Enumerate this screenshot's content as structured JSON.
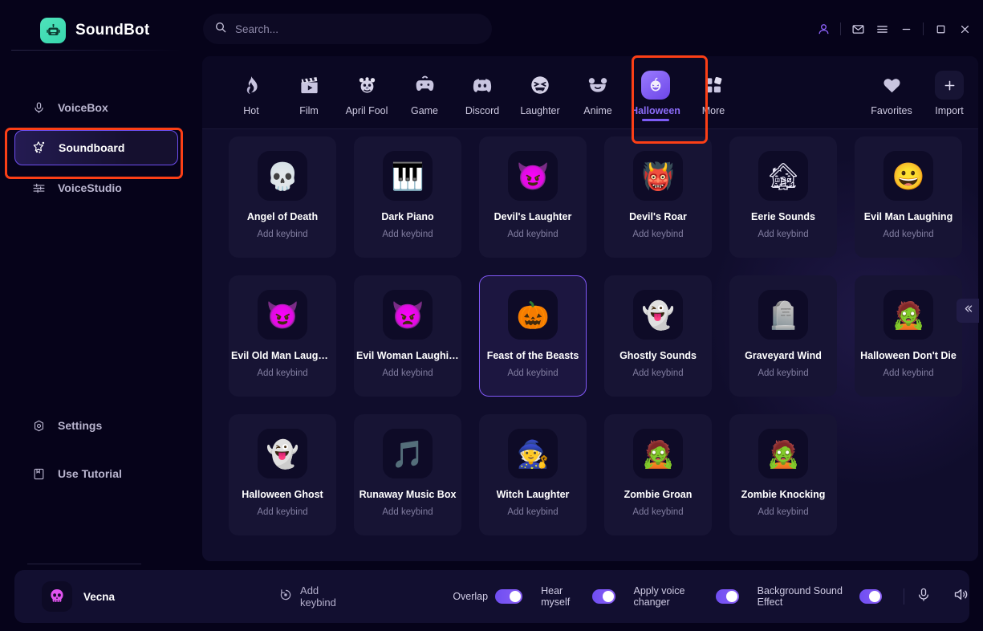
{
  "app": {
    "title": "SoundBot",
    "logo_icon": "robot-icon"
  },
  "search": {
    "placeholder": "Search...",
    "value": "",
    "icon": "search-icon"
  },
  "window_controls": [
    {
      "name": "account-icon",
      "glyph": "\u0000"
    },
    {
      "name": "mail-icon",
      "glyph": "\u0000"
    },
    {
      "name": "menu-icon",
      "glyph": "\u0000"
    },
    {
      "name": "minimize-icon",
      "glyph": "\u0000"
    },
    {
      "name": "maximize-icon",
      "glyph": "\u0000"
    },
    {
      "name": "close-icon",
      "glyph": "\u0000"
    }
  ],
  "sidebar": {
    "items": [
      {
        "label": "VoiceBox",
        "icon": "microphone-icon",
        "active": false
      },
      {
        "label": "Soundboard",
        "icon": "magic-wand-icon",
        "active": true
      },
      {
        "label": "VoiceStudio",
        "icon": "sliders-icon",
        "active": false
      }
    ],
    "bottom_items": [
      {
        "label": "Settings",
        "icon": "gear-icon"
      },
      {
        "label": "Use Tutorial",
        "icon": "book-icon"
      }
    ],
    "mini_icons": [
      {
        "name": "gift-box-icon"
      },
      {
        "name": "chat-bubble-icon"
      }
    ]
  },
  "tabs": [
    {
      "label": "Hot",
      "icon": "flame-icon",
      "active": false
    },
    {
      "label": "Film",
      "icon": "clapperboard-icon",
      "active": false
    },
    {
      "label": "April Fool",
      "icon": "clown-icon",
      "active": false
    },
    {
      "label": "Game",
      "icon": "gamepad-icon",
      "active": false
    },
    {
      "label": "Discord",
      "icon": "discord-icon",
      "active": false
    },
    {
      "label": "Laughter",
      "icon": "laughing-face-icon",
      "active": false
    },
    {
      "label": "Anime",
      "icon": "bear-face-icon",
      "active": false
    },
    {
      "label": "Halloween",
      "icon": "pumpkin-icon",
      "active": true
    },
    {
      "label": "More",
      "icon": "grid-icon",
      "active": false
    }
  ],
  "tabs_right": [
    {
      "label": "Favorites",
      "icon": "heart-icon"
    },
    {
      "label": "Import",
      "icon": "plus-icon"
    }
  ],
  "sounds": [
    {
      "title": "Angel of Death",
      "keybind": "Add keybind",
      "icon": "skull-scythe-icon",
      "emoji": "💀",
      "selected": false
    },
    {
      "title": "Dark Piano",
      "keybind": "Add keybind",
      "icon": "piano-icon",
      "emoji": "🎹",
      "selected": false
    },
    {
      "title": "Devil's Laughter",
      "keybind": "Add keybind",
      "icon": "devil-icon",
      "emoji": "😈",
      "selected": false
    },
    {
      "title": "Devil's Roar",
      "keybind": "Add keybind",
      "icon": "devil-roar-icon",
      "emoji": "👹",
      "selected": false
    },
    {
      "title": "Eerie Sounds",
      "keybind": "Add keybind",
      "icon": "haunted-house-icon",
      "emoji": "🏚",
      "selected": false
    },
    {
      "title": "Evil Man Laughing",
      "keybind": "Add keybind",
      "icon": "grinning-man-icon",
      "emoji": "😀",
      "selected": false
    },
    {
      "title": "Evil Old Man Laughing",
      "keybind": "Add keybind",
      "icon": "old-man-icon",
      "emoji": "😈",
      "selected": false
    },
    {
      "title": "Evil Woman Laughing",
      "keybind": "Add keybind",
      "icon": "she-devil-icon",
      "emoji": "👿",
      "selected": false
    },
    {
      "title": "Feast of the Beasts",
      "keybind": "Add keybind",
      "icon": "candy-skull-icon",
      "emoji": "🎃",
      "selected": true
    },
    {
      "title": "Ghostly Sounds",
      "keybind": "Add keybind",
      "icon": "ghost-icon",
      "emoji": "👻",
      "selected": false
    },
    {
      "title": "Graveyard Wind",
      "keybind": "Add keybind",
      "icon": "tombstone-icon",
      "emoji": "🪦",
      "selected": false
    },
    {
      "title": "Halloween Don't Die",
      "keybind": "Add keybind",
      "icon": "zombie-hand-icon",
      "emoji": "🧟",
      "selected": false
    },
    {
      "title": "Halloween Ghost",
      "keybind": "Add keybind",
      "icon": "evil-ghost-icon",
      "emoji": "👻",
      "selected": false
    },
    {
      "title": "Runaway Music Box",
      "keybind": "Add keybind",
      "icon": "music-box-icon",
      "emoji": "🎵",
      "selected": false
    },
    {
      "title": "Witch Laughter",
      "keybind": "Add keybind",
      "icon": "witch-icon",
      "emoji": "🧙",
      "selected": false
    },
    {
      "title": "Zombie Groan",
      "keybind": "Add keybind",
      "icon": "zombie-icon",
      "emoji": "🧟",
      "selected": false
    },
    {
      "title": "Zombie Knocking",
      "keybind": "Add keybind",
      "icon": "zombie-walk-icon",
      "emoji": "🧟",
      "selected": false
    }
  ],
  "collapse_button": {
    "icon": "chevron-double-left-icon"
  },
  "bottom_bar": {
    "voice_name": "Vecna",
    "voice_avatar_icon": "pink-skull-icon",
    "add_keybind_label": "Add keybind",
    "add_keybind_icon": "record-keybind-icon",
    "toggles": [
      {
        "label": "Overlap",
        "on": true
      },
      {
        "label": "Hear myself",
        "on": true
      },
      {
        "label": "Apply voice changer",
        "on": true
      },
      {
        "label": "Background Sound Effect",
        "on": true
      }
    ],
    "icons": [
      {
        "name": "microphone-icon"
      },
      {
        "name": "speaker-icon"
      }
    ]
  },
  "colors": {
    "accent_purple": "#7d5cf6",
    "highlight_red": "#fc3f16",
    "brand_green": "#3fd9b0",
    "panel_bg": "#100d2c",
    "app_bg": "#06031a"
  }
}
